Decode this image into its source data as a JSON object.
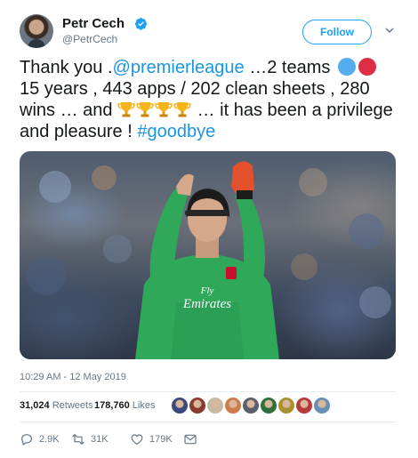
{
  "author": {
    "name": "Petr Cech",
    "handle": "@PetrCech",
    "verified_icon": "verified-badge-icon",
    "avatar_icon": "avatar"
  },
  "header": {
    "follow_label": "Follow",
    "more_icon": "chevron-down-icon"
  },
  "tweet": {
    "text_1": "Thank you .",
    "mention": "@premierleague",
    "text_2": " …2 teams ",
    "text_3": "15 years , 443 apps / 202 clean sheets , 280 wins … and ",
    "text_4": " … it has been a privilege and pleasure ! ",
    "hashtag": "#goodbye",
    "emoji": {
      "circles": [
        "blue-circle",
        "red-circle"
      ],
      "trophies": [
        "trophy",
        "trophy",
        "trophy",
        "trophy"
      ]
    },
    "timestamp": "10:29 AM - 12 May 2019"
  },
  "stats": {
    "retweets_count": "31,024",
    "retweets_label": "Retweets",
    "likes_count": "178,760",
    "likes_label": "Likes",
    "liker_avatar_colors": [
      "#3b4a7a",
      "#8a3b2d",
      "#c7b9a4",
      "#d07a4a",
      "#5a5f6a",
      "#2f6f3a",
      "#a8912f",
      "#b73a3a",
      "#6a8fb5"
    ]
  },
  "actions": {
    "reply_count": "2.9K",
    "retweet_count": "31K",
    "like_count": "179K",
    "reply_icon": "reply-icon",
    "retweet_icon": "retweet-icon",
    "like_icon": "heart-icon",
    "message_icon": "envelope-icon"
  },
  "colors": {
    "brand": "#1da1f2",
    "link": "#1b95e0",
    "muted": "#657786",
    "jersey": "#2fa85a"
  }
}
